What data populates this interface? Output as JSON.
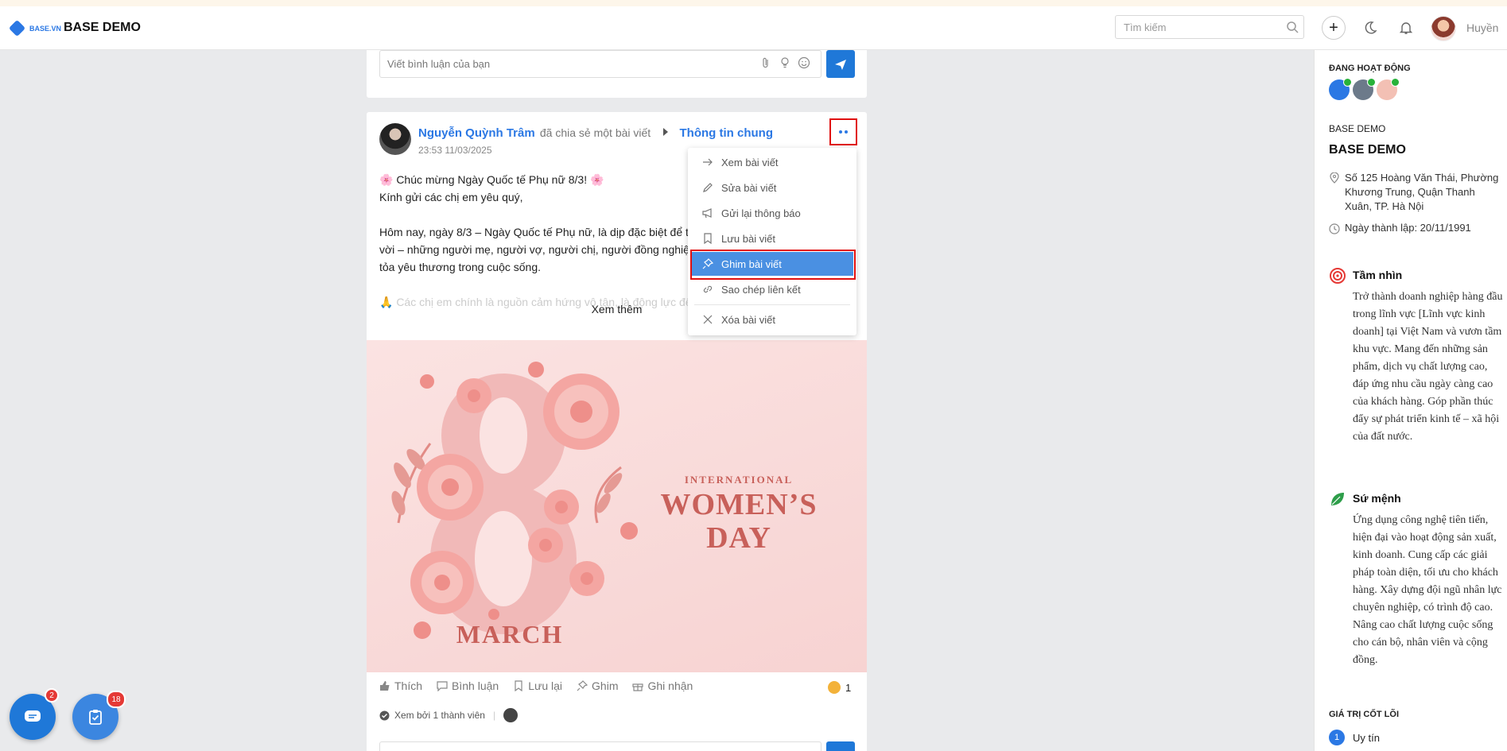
{
  "header": {
    "logo_text": "BASE.VN",
    "app_title": "BASE DEMO",
    "search_placeholder": "Tìm kiếm",
    "user_name": "Huyền"
  },
  "composer": {
    "placeholder": "Viết bình luận của bạn"
  },
  "post": {
    "author": "Nguyễn Quỳnh Trâm",
    "action": "đã chia sẻ một bài viết",
    "group": "Thông tin chung",
    "time": "23:53 11/03/2025",
    "lines": [
      "🌸 Chúc mừng Ngày Quốc tế Phụ nữ 8/3! 🌸",
      "Kính gửi các chị em yêu quý,",
      "",
      "Hôm nay, ngày 8/3 – Ngày Quốc tế Phụ nữ, là dịp đặc biệt để tô",
      "vời – những người mẹ, người vợ, người chị, người đồng nghiệp",
      "tỏa yêu thương trong cuộc sống.",
      ""
    ],
    "faded_line": "🙏 Các chị em chính là nguồn cảm hứng vô tận, là động lực để",
    "see_more": "Xem thêm",
    "banner": {
      "subtitle": "INTERNATIONAL",
      "title": "WOMEN’S DAY",
      "march": "MARCH"
    },
    "actions": [
      "Thích",
      "Bình luận",
      "Lưu lại",
      "Ghim",
      "Ghi nhận"
    ],
    "reaction_count": "1",
    "seen_text": "Xem bởi 1 thành viên"
  },
  "menu": {
    "items": [
      {
        "label": "Xem bài viết",
        "icon": "arrow-right-icon"
      },
      {
        "label": "Sửa bài viết",
        "icon": "pencil-icon"
      },
      {
        "label": "Gửi lại thông báo",
        "icon": "megaphone-icon"
      },
      {
        "label": "Lưu bài viết",
        "icon": "bookmark-icon"
      },
      {
        "label": "Ghim bài viết",
        "icon": "pin-icon",
        "active": true
      },
      {
        "label": "Sao chép liên kết",
        "icon": "link-icon"
      },
      {
        "label": "Xóa bài viết",
        "icon": "close-icon"
      }
    ]
  },
  "sidebar": {
    "online_label": "ĐANG HOẠT ĐỘNG",
    "company_label": "BASE DEMO",
    "company_name": "BASE DEMO",
    "address": "Số 125 Hoàng Văn Thái, Phường Khương Trung, Quận Thanh Xuân, TP. Hà Nội",
    "founded": "Ngày thành lập: 20/11/1991",
    "vision_title": "Tầm nhìn",
    "vision_text": "Trở thành doanh nghiệp hàng đầu trong lĩnh vực [Lĩnh vực kinh doanh] tại Việt Nam và vươn tầm khu vực. Mang đến những sản phẩm, dịch vụ chất lượng cao, đáp ứng nhu cầu ngày càng cao của khách hàng. Góp phần thúc đẩy sự phát triển kinh tế – xã hội của đất nước.",
    "mission_title": "Sứ mệnh",
    "mission_text": "Ứng dụng công nghệ tiên tiến, hiện đại vào hoạt động sản xuất, kinh doanh. Cung cấp các giải pháp toàn diện, tối ưu cho khách hàng. Xây dựng đội ngũ nhân lực chuyên nghiệp, có trình độ cao. Nâng cao chất lượng cuộc sống cho cán bộ, nhân viên và cộng đồng.",
    "values_label": "GIÁ TRỊ CỐT LÕI",
    "value1_num": "1",
    "value1_label": "Uy tín"
  },
  "fabs": {
    "chat_badge": "2",
    "task_badge": "18"
  },
  "colors": {
    "accent": "#2b78e4",
    "highlight": "#e01010",
    "menu_active": "#4a90e2"
  }
}
